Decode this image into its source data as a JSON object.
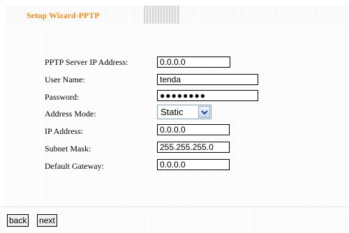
{
  "header": {
    "title": "Setup Wizard-PPTP"
  },
  "form": {
    "server_ip": {
      "label": "PPTP Server IP Address:",
      "value": "0.0.0.0"
    },
    "user_name": {
      "label": "User Name:",
      "value": "tenda"
    },
    "password": {
      "label": "Password:",
      "value": "●●●●●●●●"
    },
    "address_mode": {
      "label": "Address Mode:",
      "value": "Static"
    },
    "ip_address": {
      "label": "IP Address:",
      "value": "0.0.0.0"
    },
    "subnet_mask": {
      "label": "Subnet Mask:",
      "value": "255.255.255.0"
    },
    "default_gateway": {
      "label": "Default Gateway:",
      "value": "0.0.0.0"
    }
  },
  "buttons": {
    "back": "back",
    "next": "next"
  },
  "colors": {
    "title": "#f08c1c",
    "select_border": "#7f9db9"
  },
  "icons": {
    "dropdown": "chevron-down-icon"
  }
}
